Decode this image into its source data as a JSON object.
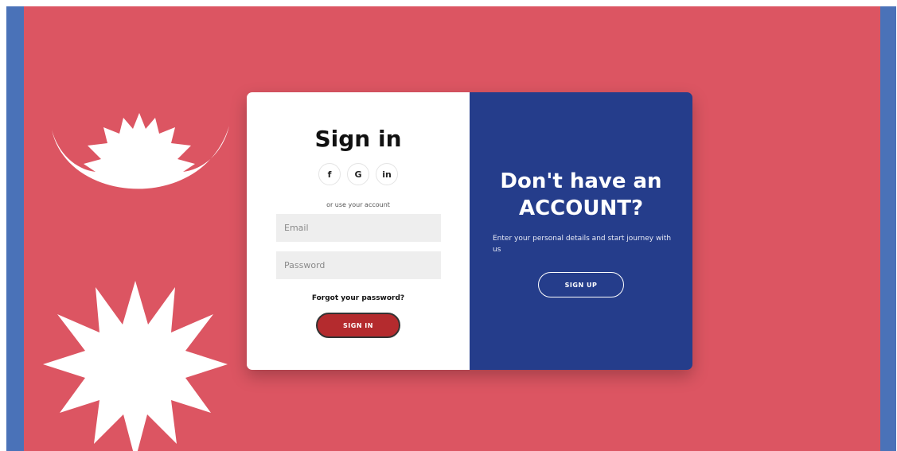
{
  "signin": {
    "title": "Sign in",
    "social_buttons": [
      {
        "label": "f",
        "icon": "facebook-icon"
      },
      {
        "label": "G",
        "icon": "google-icon"
      },
      {
        "label": "in",
        "icon": "linkedin-icon"
      }
    ],
    "alt_text": "or use your account",
    "email_placeholder": "Email",
    "password_placeholder": "Password",
    "forgot_text": "Forgot your password?",
    "button_label": "SIGN IN"
  },
  "signup": {
    "title_line1": "Don't have an",
    "title_line2": "ACCOUNT?",
    "description": "Enter your personal details and start journey with us",
    "button_label": "SIGN UP"
  },
  "colors": {
    "background": "#dc5562",
    "border": "#4a72b8",
    "panel_right": "#253d8b",
    "signin_button": "#b42b2e"
  }
}
